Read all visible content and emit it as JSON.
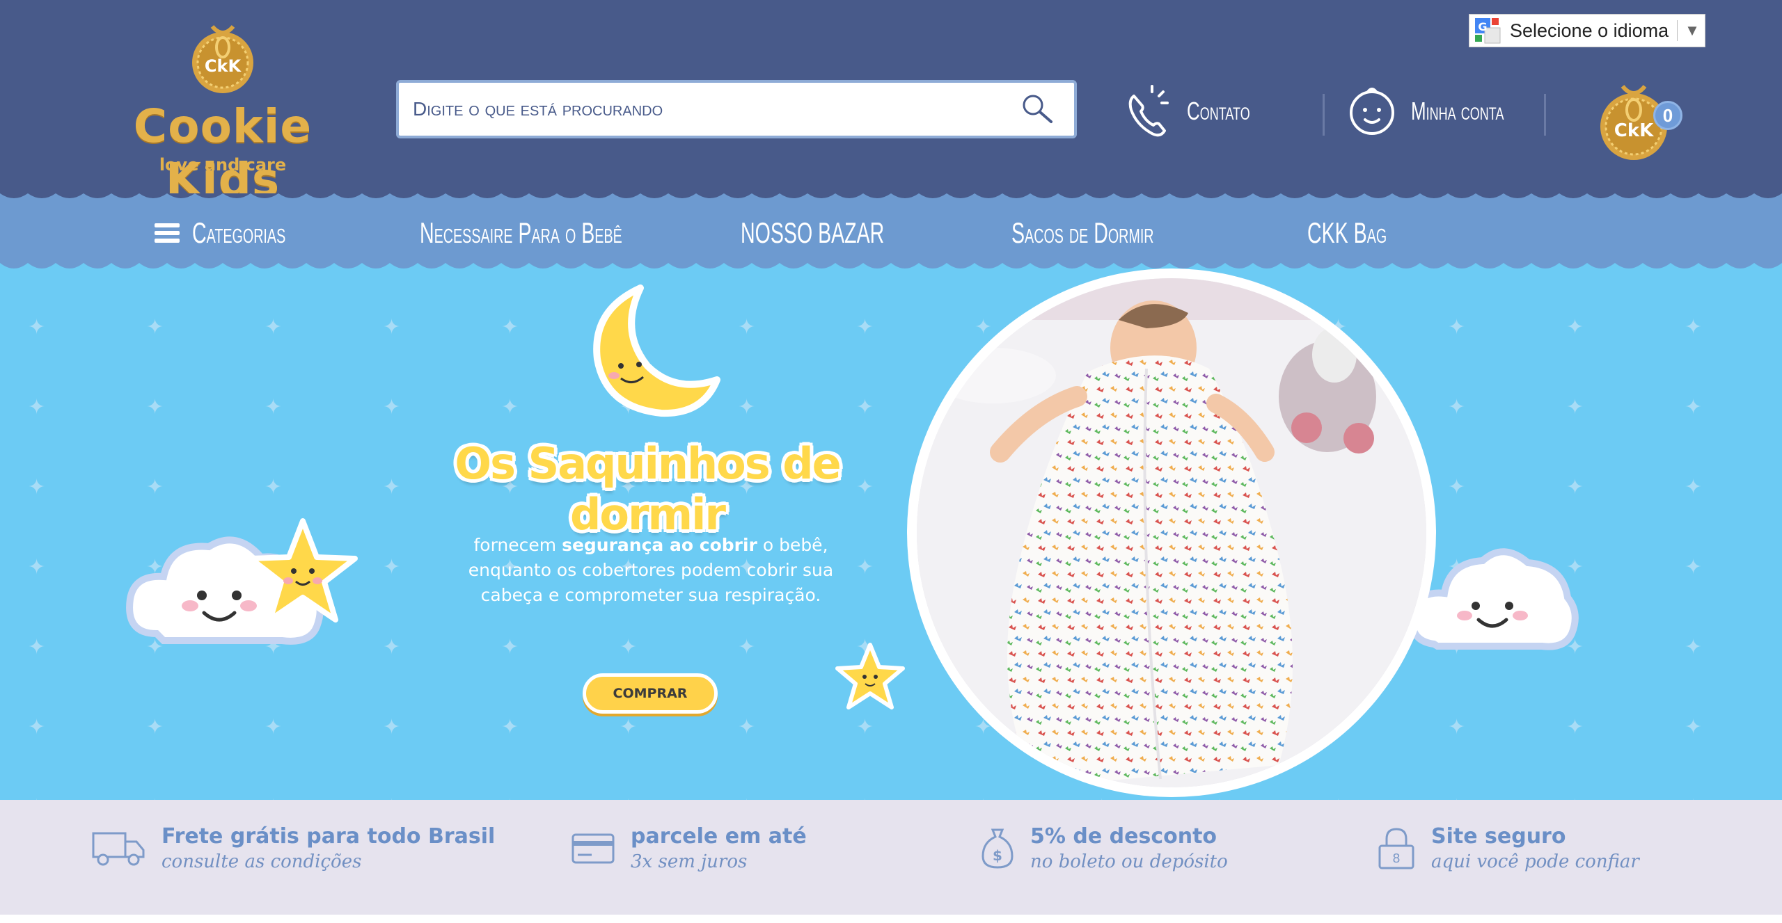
{
  "brand": {
    "badge_text": "CkK",
    "name": "Cookie Kids",
    "tagline": "love and care"
  },
  "language": {
    "label": "Selecione o idioma",
    "arrow": "▼"
  },
  "search": {
    "placeholder": "Digite o que está procurando",
    "icon": "search-icon"
  },
  "header_links": {
    "contact": "Contato",
    "account": "Minha conta"
  },
  "cart": {
    "badge_text": "CkK",
    "count": "0"
  },
  "nav": {
    "categories": "Categorias",
    "items": [
      "Necessaire Para o Bebê",
      "NOSSO BAZAR",
      "Sacos de Dormir",
      "CKK Bag"
    ]
  },
  "hero": {
    "title": "Os Saquinhos de dormir",
    "text_part1": "fornecem ",
    "text_bold": "segurança ao cobrir",
    "text_part2": " o bebê, enquanto os cobertores podem cobrir sua cabeça e comprometer sua respiração.",
    "button": "COMPRAR"
  },
  "features": [
    {
      "icon": "truck-icon",
      "title": "Frete grátis para todo Brasil",
      "subtitle": "consulte as condições"
    },
    {
      "icon": "credit-card-icon",
      "title": "parcele em até",
      "subtitle": "3x sem juros"
    },
    {
      "icon": "money-bag-icon",
      "title": "5% de desconto",
      "subtitle": "no boleto ou depósito"
    },
    {
      "icon": "padlock-icon",
      "title": "Site seguro",
      "subtitle": "aqui você pode confiar"
    }
  ],
  "colors": {
    "header_bg": "#485a8a",
    "nav_bg": "#6d9ad0",
    "hero_bg": "#6ccbf4",
    "gold": "#e3b14a",
    "button_yellow": "#ffd24a",
    "features_bg": "#e6e3ee"
  }
}
